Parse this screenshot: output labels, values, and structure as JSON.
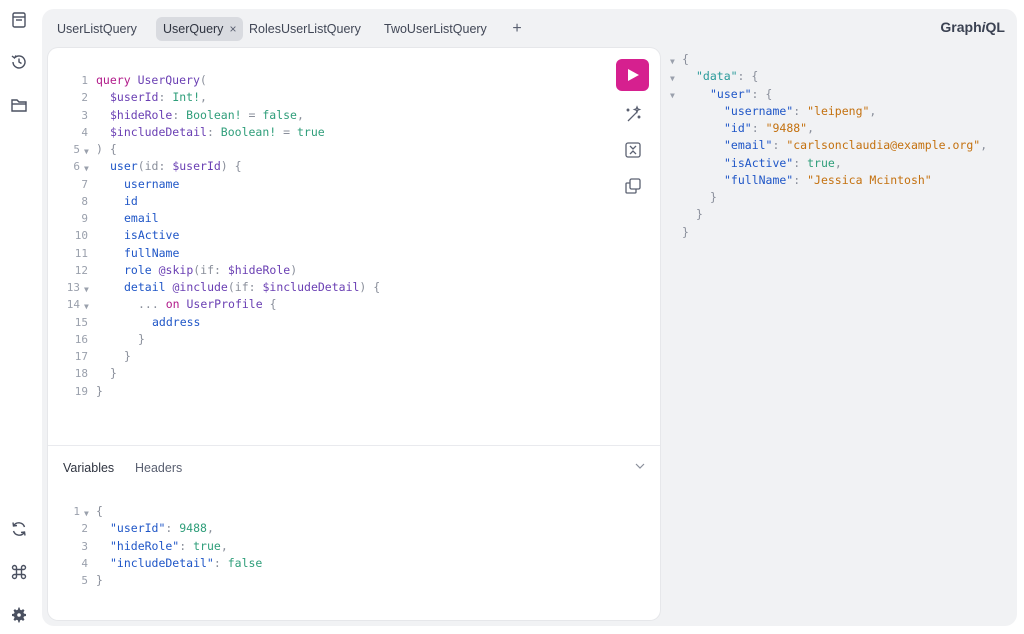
{
  "tabs": [
    {
      "label": "UserListQuery"
    },
    {
      "label": "UserQuery",
      "close": "×"
    },
    {
      "label": "RolesUserListQuery"
    },
    {
      "label": "TwoUserListQuery"
    }
  ],
  "add_tab": "+",
  "brand": {
    "prefix": "Graph",
    "italic": "i",
    "suffix": "QL"
  },
  "query_lines": [
    "1",
    "2",
    "3",
    "4",
    "5",
    "6",
    "7",
    "8",
    "9",
    "10",
    "11",
    "12",
    "13",
    "14",
    "15",
    "16",
    "17",
    "18",
    "19"
  ],
  "query": {
    "l1_kw": "query",
    "l1_name": "UserQuery",
    "l1_p": "(",
    "l2_var": "$userId",
    "l2_c": ": ",
    "l2_type": "Int!",
    "l2_p": ",",
    "l3_var": "$hideRole",
    "l3_c": ": ",
    "l3_type": "Boolean!",
    "l3_eq": " = ",
    "l3_val": "false",
    "l3_p": ",",
    "l4_var": "$includeDetail",
    "l4_c": ": ",
    "l4_type": "Boolean!",
    "l4_eq": " = ",
    "l4_val": "true",
    "l5": ") {",
    "l6_f": "user",
    "l6_a": "(id: ",
    "l6_v": "$userId",
    "l6_e": ") {",
    "l7": "username",
    "l8": "id",
    "l9": "email",
    "l10": "isActive",
    "l11": "fullName",
    "l12_f": "role",
    "l12_d": " @skip",
    "l12_a": "(if: ",
    "l12_v": "$hideRole",
    "l12_e": ")",
    "l13_f": "detail",
    "l13_d": " @include",
    "l13_a": "(if: ",
    "l13_v": "$includeDetail",
    "l13_e": ") {",
    "l14_dots": "...",
    "l14_on": " on ",
    "l14_t": "UserProfile",
    "l14_e": " {",
    "l15": "address",
    "l16": "}",
    "l17": "}",
    "l18": "}",
    "l19": "}"
  },
  "variables_tab": "Variables",
  "headers_tab": "Headers",
  "vars_lines": [
    "1",
    "2",
    "3",
    "4",
    "5"
  ],
  "vars": {
    "l1": "{",
    "l2_k": "\"userId\"",
    "l2_c": ": ",
    "l2_v": "9488",
    "l2_p": ",",
    "l3_k": "\"hideRole\"",
    "l3_c": ": ",
    "l3_v": "true",
    "l3_p": ",",
    "l4_k": "\"includeDetail\"",
    "l4_c": ": ",
    "l4_v": "false",
    "l5": "}"
  },
  "result": {
    "r1": "{",
    "r2_k": "\"data\"",
    "r2_e": ": {",
    "r3_k": "\"user\"",
    "r3_e": ": {",
    "r4_k": "\"username\"",
    "r4_c": ": ",
    "r4_v": "\"leipeng\"",
    "r4_p": ",",
    "r5_k": "\"id\"",
    "r5_c": ": ",
    "r5_v": "\"9488\"",
    "r5_p": ",",
    "r6_k": "\"email\"",
    "r6_c": ": ",
    "r6_v": "\"carlsonclaudia@example.org\"",
    "r6_p": ",",
    "r7_k": "\"isActive\"",
    "r7_c": ": ",
    "r7_v": "true",
    "r7_p": ",",
    "r8_k": "\"fullName\"",
    "r8_c": ": ",
    "r8_v": "\"Jessica Mcintosh\"",
    "r9": "}",
    "r10": "}",
    "r11": "}"
  },
  "colors": {
    "run_button": "#d6208f",
    "shell_bg": "#f1f2f4"
  }
}
